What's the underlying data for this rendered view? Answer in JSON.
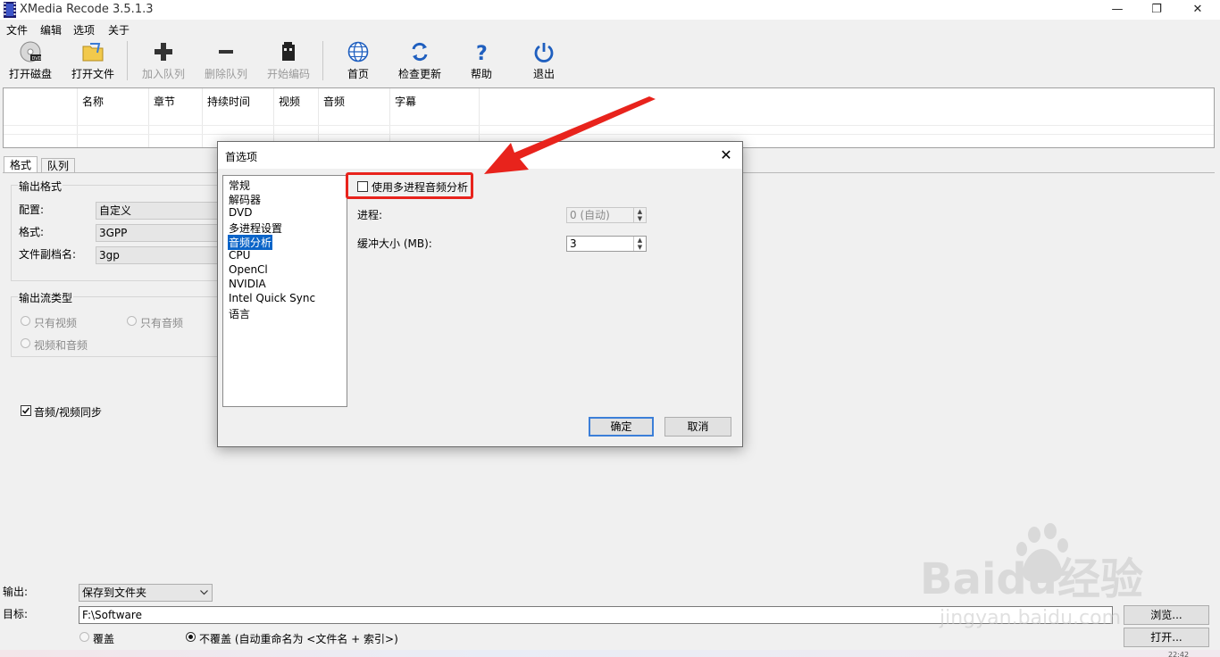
{
  "window": {
    "title": "XMedia Recode 3.5.1.3",
    "minimize": "—",
    "restore": "❐",
    "close": "✕"
  },
  "menu": [
    "文件",
    "编辑",
    "选项",
    "关于"
  ],
  "toolbar": {
    "open_disc": "打开磁盘",
    "open_file": "打开文件",
    "add_queue": "加入队列",
    "remove_queue": "删除队列",
    "start_encode": "开始编码",
    "home": "首页",
    "check_update": "检查更新",
    "help": "帮助",
    "exit": "退出"
  },
  "file_list": {
    "columns": [
      "名称",
      "章节",
      "持续时间",
      "视频",
      "音频",
      "字幕"
    ]
  },
  "tabs": [
    "格式",
    "队列"
  ],
  "format_panel": {
    "output_format_group": "输出格式",
    "config_label": "配置:",
    "config_value": "自定义",
    "format_label": "格式:",
    "format_value": "3GPP",
    "ext_label": "文件副档名:",
    "ext_value": "3gp",
    "stream_group": "输出流类型",
    "video_only": "只有视频",
    "audio_only": "只有音频",
    "video_audio": "视频和音频",
    "av_sync": "音频/视频同步"
  },
  "bottom": {
    "output_label": "输出:",
    "output_value": "保存到文件夹",
    "target_label": "目标:",
    "target_value": "F:\\Software",
    "browse": "浏览...",
    "open": "打开...",
    "overwrite": "覆盖",
    "no_overwrite": "不覆盖 (自动重命名为 <文件名 + 索引>)",
    "clock_partial": "22:42"
  },
  "dialog": {
    "title": "首选项",
    "close": "✕",
    "categories": [
      "常规",
      "解码器",
      "DVD",
      "多进程设置",
      "音频分析",
      "CPU",
      "OpenCl",
      "NVIDIA",
      "Intel Quick Sync",
      "语言"
    ],
    "selected_category": "音频分析",
    "checkbox_label": "使用多进程音频分析",
    "process_label": "进程:",
    "process_value": "0 (自动)",
    "buffer_label": "缓冲大小 (MB):",
    "buffer_value": "3",
    "ok": "确定",
    "cancel": "取消"
  },
  "watermark": {
    "brand": "Baidu经验",
    "url": "jingyan.baidu.com"
  },
  "colors": {
    "annotation_red": "#e8231c",
    "selection_blue": "#0a64c8"
  }
}
